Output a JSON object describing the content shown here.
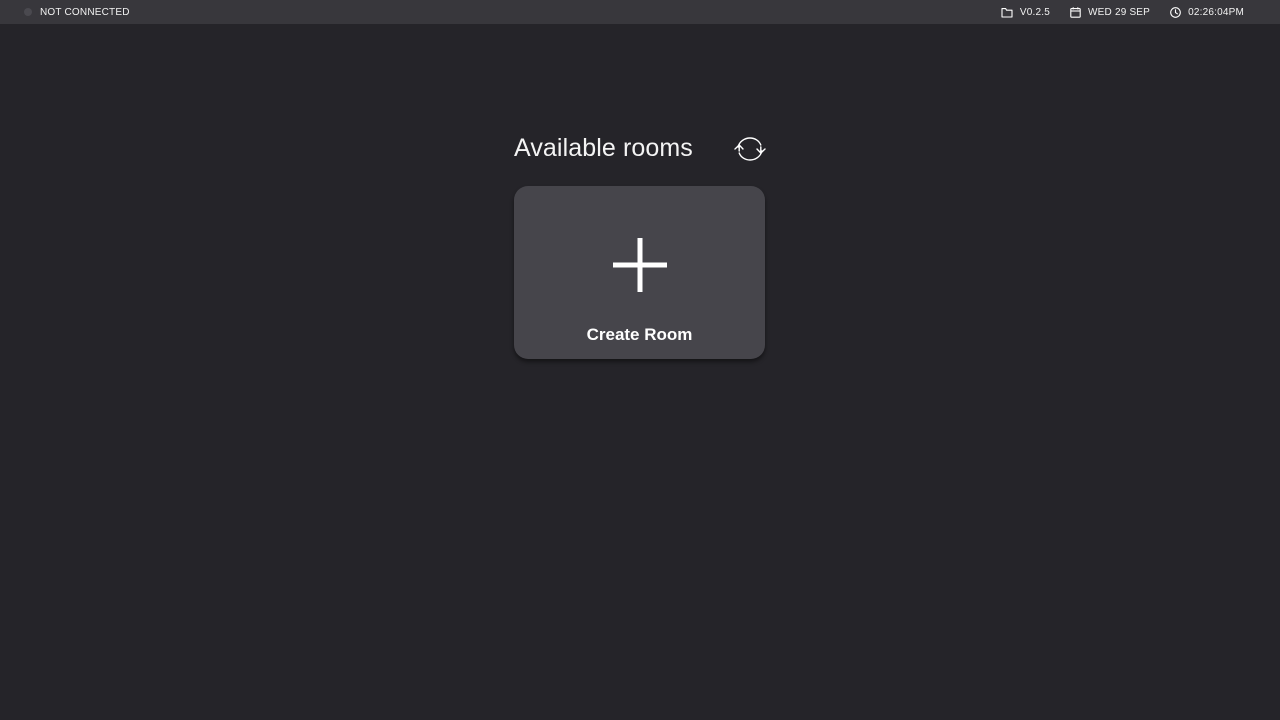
{
  "statusbar": {
    "connection": "NOT CONNECTED",
    "version": "V0.2.5",
    "date": "WED 29 SEP",
    "time": "02:26:04PM",
    "icons": {
      "connection": "status-dot-icon",
      "version": "folder-icon",
      "date": "calendar-icon",
      "time": "clock-icon"
    }
  },
  "main": {
    "title": "Available rooms",
    "refresh_icon": "refresh-icon",
    "create_room": {
      "label": "Create Room",
      "icon": "plus-icon"
    }
  },
  "colors": {
    "background": "#252429",
    "statusbar": "#38373c",
    "card": "#46454b",
    "text": "#ffffff"
  }
}
